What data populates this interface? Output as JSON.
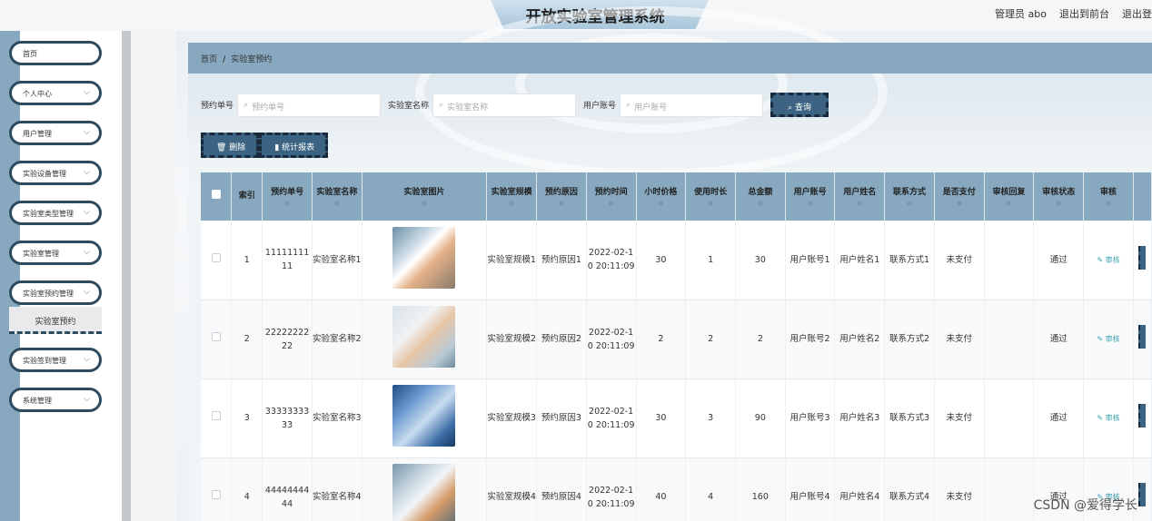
{
  "header": {
    "title": "开放实验室管理系统",
    "user": "管理员 abo",
    "back_front": "退出到前台",
    "logout": "退出登"
  },
  "sidebar": {
    "items": [
      {
        "label": "首页",
        "chevron": false
      },
      {
        "label": "个人中心",
        "chevron": true
      },
      {
        "label": "用户管理",
        "chevron": true
      },
      {
        "label": "实验设备管理",
        "chevron": true
      },
      {
        "label": "实验室类型管理",
        "chevron": true
      },
      {
        "label": "实验室管理",
        "chevron": true
      },
      {
        "label": "实验室预约管理",
        "chevron": true
      },
      {
        "label": "实验签到管理",
        "chevron": true
      },
      {
        "label": "系统管理",
        "chevron": true
      }
    ],
    "active_sub": "实验室预约"
  },
  "breadcrumb": {
    "home": "首页",
    "sep": "/",
    "current": "实验室预约"
  },
  "search": {
    "fields": [
      {
        "label": "预约单号",
        "placeholder": "预约单号"
      },
      {
        "label": "实验室名称",
        "placeholder": "实验室名称"
      },
      {
        "label": "用户账号",
        "placeholder": "用户账号"
      }
    ],
    "query_label": "查询"
  },
  "actions": {
    "delete_label": "删除",
    "report_label": "统计报表"
  },
  "table": {
    "columns": [
      "索引",
      "预约单号",
      "实验室名称",
      "实验室图片",
      "实验室规模",
      "预约原因",
      "预约时间",
      "小时价格",
      "使用时长",
      "总金额",
      "用户账号",
      "用户姓名",
      "联系方式",
      "是否支付",
      "审核回复",
      "审核状态",
      "审核"
    ],
    "rows": [
      {
        "index": "1",
        "order_no": "1111111111",
        "lab_name": "实验室名称1",
        "scale": "实验室规模1",
        "reason": "预约原因1",
        "time": "2022-02-10 20:11:09",
        "price": "30",
        "hours": "1",
        "total": "30",
        "account": "用户账号1",
        "name": "用户姓名1",
        "contact": "联系方式1",
        "paid": "未支付",
        "reply": "",
        "status": "通过",
        "audit": "审核"
      },
      {
        "index": "2",
        "order_no": "2222222222",
        "lab_name": "实验室名称2",
        "scale": "实验室规模2",
        "reason": "预约原因2",
        "time": "2022-02-10 20:11:09",
        "price": "2",
        "hours": "2",
        "total": "2",
        "account": "用户账号2",
        "name": "用户姓名2",
        "contact": "联系方式2",
        "paid": "未支付",
        "reply": "",
        "status": "通过",
        "audit": "审核"
      },
      {
        "index": "3",
        "order_no": "3333333333",
        "lab_name": "实验室名称3",
        "scale": "实验室规模3",
        "reason": "预约原因3",
        "time": "2022-02-10 20:11:09",
        "price": "30",
        "hours": "3",
        "total": "90",
        "account": "用户账号3",
        "name": "用户姓名3",
        "contact": "联系方式3",
        "paid": "未支付",
        "reply": "",
        "status": "通过",
        "audit": "审核"
      },
      {
        "index": "4",
        "order_no": "4444444444",
        "lab_name": "实验室名称4",
        "scale": "实验室规模4",
        "reason": "预约原因4",
        "time": "2022-02-10 20:11:09",
        "price": "40",
        "hours": "4",
        "total": "160",
        "account": "用户账号4",
        "name": "用户姓名4",
        "contact": "联系方式4",
        "paid": "未支付",
        "reply": "",
        "status": "通过",
        "audit": "审核"
      }
    ]
  },
  "watermark": "CSDN @爱得学长",
  "colors": {
    "header_bar": "#87a8bf",
    "button": "#3c6482",
    "border": "#2e4a5f"
  }
}
